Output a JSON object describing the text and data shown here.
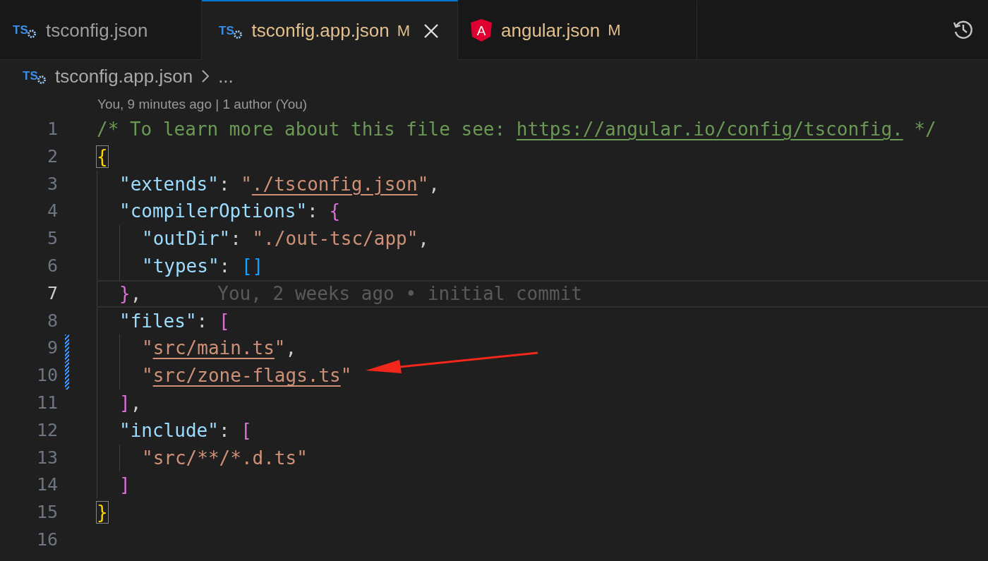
{
  "tabs": [
    {
      "label": "tsconfig.json",
      "kind": "ts",
      "icon_label": "TS",
      "selected": false,
      "modified": false
    },
    {
      "label": "tsconfig.app.json",
      "kind": "ts",
      "icon_label": "TS",
      "selected": true,
      "modified": true,
      "badge": "M"
    },
    {
      "label": "angular.json",
      "kind": "angular",
      "icon_label": "A",
      "selected": false,
      "modified": true,
      "badge": "M"
    }
  ],
  "breadcrumb": {
    "kind": "ts",
    "icon_label": "TS",
    "file": "tsconfig.app.json",
    "more": "..."
  },
  "codelens": "You, 9 minutes ago | 1 author (You)",
  "lines": [
    {
      "number": "1",
      "current": false,
      "modified": false,
      "tokens": [
        {
          "kind": "comment",
          "text": "/* To learn more about this file see: "
        },
        {
          "kind": "comment-link",
          "text": "https://angular.io/config/tsconfig."
        },
        {
          "kind": "comment",
          "text": " */"
        }
      ]
    },
    {
      "number": "2",
      "current": false,
      "modified": false,
      "tokens": [
        {
          "kind": "brace",
          "text": "{",
          "matched": true
        }
      ],
      "children": [
        {
          "number": "3",
          "current": false,
          "modified": false,
          "tokens": [
            {
              "kind": "key",
              "text": "\"extends\""
            },
            {
              "kind": "punct",
              "text": ": "
            },
            {
              "kind": "string",
              "text": "\""
            },
            {
              "kind": "string-link",
              "text": "./tsconfig.json"
            },
            {
              "kind": "string",
              "text": "\""
            },
            {
              "kind": "punct",
              "text": ","
            }
          ]
        },
        {
          "number": "4",
          "current": false,
          "modified": false,
          "tokens": [
            {
              "kind": "key",
              "text": "\"compilerOptions\""
            },
            {
              "kind": "punct",
              "text": ": "
            },
            {
              "kind": "bracket",
              "text": "{"
            }
          ],
          "children": [
            {
              "number": "5",
              "current": false,
              "modified": false,
              "tokens": [
                {
                  "kind": "key",
                  "text": "\"outDir\""
                },
                {
                  "kind": "punct",
                  "text": ": "
                },
                {
                  "kind": "string",
                  "text": "\"./out-tsc/app\""
                },
                {
                  "kind": "punct",
                  "text": ","
                }
              ]
            },
            {
              "number": "6",
              "current": false,
              "modified": false,
              "tokens": [
                {
                  "kind": "key",
                  "text": "\"types\""
                },
                {
                  "kind": "punct",
                  "text": ": "
                },
                {
                  "kind": "bracket-inner",
                  "text": "[]"
                }
              ]
            }
          ]
        },
        {
          "number": "7",
          "current": true,
          "modified": false,
          "tokens": [
            {
              "kind": "bracket",
              "text": "}"
            },
            {
              "kind": "punct",
              "text": ","
            }
          ],
          "blame": "You, 2 weeks ago • initial commit"
        },
        {
          "number": "8",
          "current": false,
          "modified": false,
          "tokens": [
            {
              "kind": "key",
              "text": "\"files\""
            },
            {
              "kind": "punct",
              "text": ": "
            },
            {
              "kind": "bracket",
              "text": "["
            }
          ],
          "children": [
            {
              "number": "9",
              "current": false,
              "modified": true,
              "tokens": [
                {
                  "kind": "string",
                  "text": "\""
                },
                {
                  "kind": "string-link",
                  "text": "src/main.ts"
                },
                {
                  "kind": "string",
                  "text": "\""
                },
                {
                  "kind": "punct",
                  "text": ","
                }
              ]
            },
            {
              "number": "10",
              "current": false,
              "modified": true,
              "tokens": [
                {
                  "kind": "string",
                  "text": "\""
                },
                {
                  "kind": "string-link",
                  "text": "src/zone-flags.ts"
                },
                {
                  "kind": "string",
                  "text": "\""
                }
              ]
            }
          ]
        },
        {
          "number": "11",
          "current": false,
          "modified": false,
          "tokens": [
            {
              "kind": "bracket",
              "text": "]"
            },
            {
              "kind": "punct",
              "text": ","
            }
          ]
        },
        {
          "number": "12",
          "current": false,
          "modified": false,
          "tokens": [
            {
              "kind": "key",
              "text": "\"include\""
            },
            {
              "kind": "punct",
              "text": ": "
            },
            {
              "kind": "bracket",
              "text": "["
            }
          ],
          "children": [
            {
              "number": "13",
              "current": false,
              "modified": false,
              "tokens": [
                {
                  "kind": "string",
                  "text": "\"src/**/*.d.ts\""
                }
              ]
            }
          ]
        },
        {
          "number": "14",
          "current": false,
          "modified": false,
          "tokens": [
            {
              "kind": "bracket",
              "text": "]"
            }
          ]
        }
      ]
    },
    {
      "number": "15",
      "current": false,
      "modified": false,
      "tokens": [
        {
          "kind": "brace",
          "text": "}",
          "matched": true
        }
      ]
    },
    {
      "number": "16",
      "current": false,
      "modified": false
    }
  ]
}
